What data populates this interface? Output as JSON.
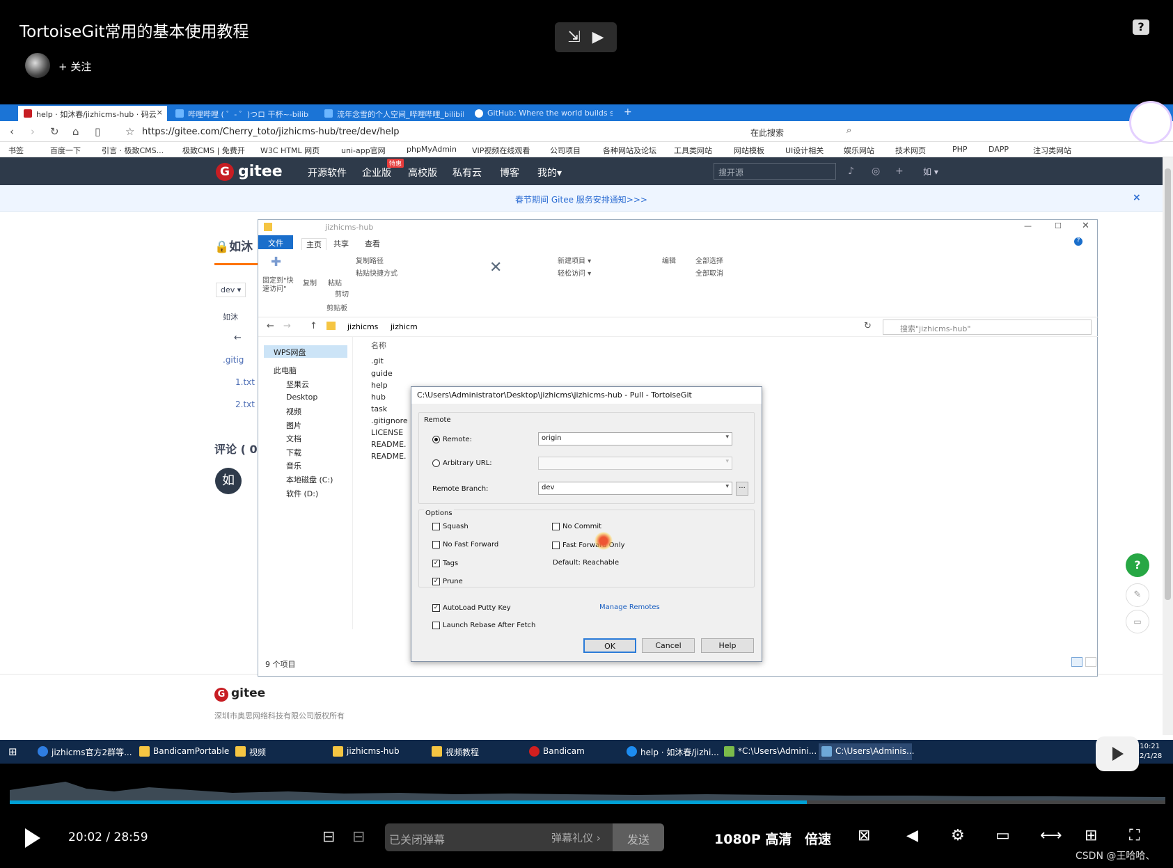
{
  "video": {
    "title": "TortoiseGit常用的基本使用教程",
    "follow": "+ 关注",
    "help": "?"
  },
  "browser": {
    "tabs": [
      {
        "label": "help · 如沐春/jizhicms-hub · 码云",
        "close": "×",
        "active": true
      },
      {
        "label": "哔哩哔哩 ( ゜- ゜)つロ 干杯~-bilibili",
        "active": false
      },
      {
        "label": "流年念雪的个人空间_哔哩哔哩_bilibili",
        "active": false
      },
      {
        "label": "GitHub: Where the world builds s",
        "active": false
      }
    ],
    "new_tab": "+",
    "url": "https://gitee.com/Cherry_toto/jizhicms-hub/tree/dev/help",
    "search_here": "在此搜索",
    "bookmarks": [
      "书签",
      "百度一下",
      "引言 · 极致CMS...",
      "极致CMS | 免费开",
      "W3C HTML 网页",
      "uni-app官网",
      "phpMyAdmin",
      "VIP视频在线观看",
      "公司项目",
      "各种网站及论坛",
      "工具类网站",
      "网站模板",
      "UI设计相关",
      "娱乐网站",
      "技术网页",
      "PHP",
      "DAPP",
      "注习类网站"
    ]
  },
  "gitee": {
    "logo": "gitee",
    "nav": [
      "开源软件",
      "企业版",
      "高校版",
      "私有云",
      "博客",
      "我的▾"
    ],
    "badge": "特惠",
    "search_placeholder": "搜开源",
    "user": "如 ▾",
    "notice": "春节期间 Gitee 服务安排通知>>>",
    "notice_close": "×",
    "repo_title": "如沐",
    "branch": "dev ▾",
    "commit_user": "如沐",
    "files": [
      ".gitig",
      "1.txt",
      "2.txt"
    ],
    "comments": "评论 ( 0",
    "avatar_char": "如",
    "footer_logo": "gitee",
    "footer_text": "深圳市奥思网络科技有限公司版权所有",
    "float_help": "?"
  },
  "explorer": {
    "title": "jizhicms-hub",
    "tabs": [
      "文件",
      "主页",
      "共享",
      "查看"
    ],
    "ribbon": {
      "pin": "固定到\"快速访问\"",
      "copy": "复制",
      "paste": "粘贴",
      "copy_path": "复制路径",
      "paste_shortcut": "粘贴快捷方式",
      "cut": "剪切",
      "clipboard": "剪贴板",
      "new_item": "新建项目 ▾",
      "easy_access": "轻松访问 ▾",
      "edit": "编辑",
      "select_all": "全部选择",
      "select_none": "全部取消"
    },
    "path": [
      "jizhicms",
      "jizhicm"
    ],
    "search_placeholder": "搜索\"jizhicms-hub\"",
    "nav": [
      "WPS网盘",
      "此电脑",
      "坚果云",
      "Desktop",
      "视频",
      "图片",
      "文档",
      "下载",
      "音乐",
      "本地磁盘 (C:)",
      "软件 (D:)"
    ],
    "column": "名称",
    "files": [
      ".git",
      "guide",
      "help",
      "hub",
      "task",
      ".gitignore",
      "LICENSE",
      "README.",
      "README."
    ],
    "status": "9 个项目"
  },
  "dialog": {
    "title": "C:\\Users\\Administrator\\Desktop\\jizhicms\\jizhicms-hub - Pull - TortoiseGit",
    "remote_group": "Remote",
    "remote_label": "Remote:",
    "remote_value": "origin",
    "arbitrary_label": "Arbitrary URL:",
    "remote_branch_label": "Remote Branch:",
    "remote_branch_value": "dev",
    "browse": "...",
    "options_group": "Options",
    "squash": "Squash",
    "no_commit": "No Commit",
    "no_fast_forward": "No Fast Forward",
    "fast_forward_only": "Fast Forward Only",
    "tags": "Tags",
    "default_reachable": "Default: Reachable",
    "prune": "Prune",
    "autoload": "AutoLoad Putty Key",
    "manage_remotes": "Manage Remotes",
    "launch_rebase": "Launch Rebase After Fetch",
    "ok": "OK",
    "cancel": "Cancel",
    "help": "Help",
    "check_mark": "✓"
  },
  "taskbar": {
    "items": [
      "jizhicms官方2群等...",
      "BandicamPortable",
      "视频",
      "jizhicms-hub",
      "视频教程",
      "Bandicam",
      "help · 如沐春/jizhi...",
      "*C:\\Users\\Admini...",
      "C:\\Users\\Adminis..."
    ],
    "time": "13:10:21",
    "date": "2022/1/28"
  },
  "player": {
    "current_time": "20:02",
    "separator": "/",
    "duration": "28:59",
    "progress": 0.69,
    "danmu_placeholder": "已关闭弹幕",
    "danmu_gift": "弹幕礼仪 ›",
    "send": "发送",
    "quality": "1080P 高清",
    "speed": "倍速",
    "watermark": "CSDN @王哈哈、"
  },
  "colors": {
    "browser_tab": "#1b74d6",
    "gitee_nav": "#2e3a4a",
    "gitee_brand": "#c71d23",
    "progress": "#00a1d6",
    "taskbar": "#10294a"
  }
}
